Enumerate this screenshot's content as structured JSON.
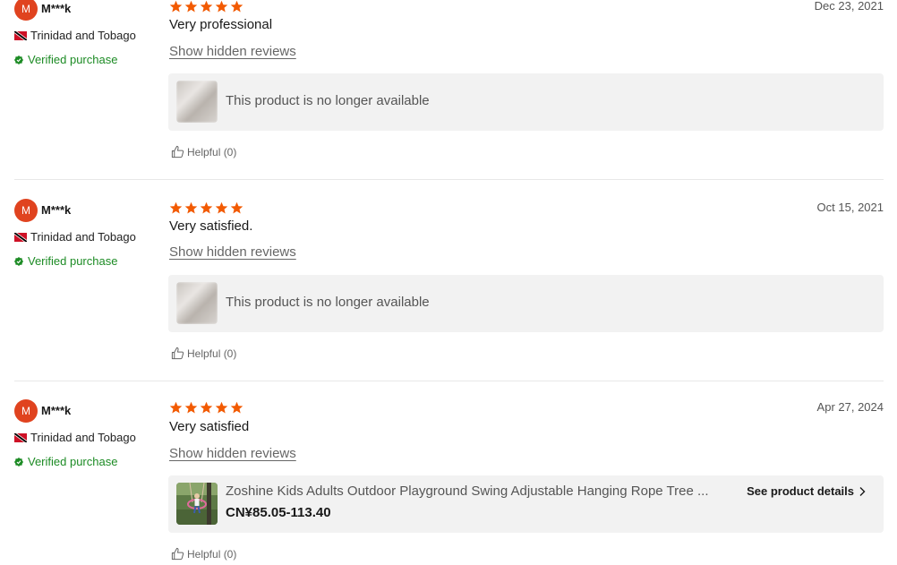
{
  "colors": {
    "star": "#f25a02",
    "avatar": "#e0431f",
    "verified": "#1c8b24"
  },
  "reviews": [
    {
      "avatar_letter": "M",
      "author": "M***k",
      "country": "Trinidad and Tobago",
      "verified": "Verified purchase",
      "rating": 5,
      "date": "Dec 23, 2021",
      "text": "Very professional",
      "show_hidden": "Show hidden reviews",
      "product_message": "This product is no longer available",
      "helpful": "Helpful (0)"
    },
    {
      "avatar_letter": "M",
      "author": "M***k",
      "country": "Trinidad and Tobago",
      "verified": "Verified purchase",
      "rating": 5,
      "date": "Oct 15, 2021",
      "text": "Very satisfied.",
      "show_hidden": "Show hidden reviews",
      "product_message": "This product is no longer available",
      "helpful": "Helpful (0)"
    },
    {
      "avatar_letter": "M",
      "author": "M***k",
      "country": "Trinidad and Tobago",
      "verified": "Verified purchase",
      "rating": 5,
      "date": "Apr 27, 2024",
      "text": "Very satisfied",
      "show_hidden": "Show hidden reviews",
      "product_title": "Zoshine Kids Adults Outdoor Playground Swing Adjustable Hanging Rope Tree ...",
      "product_price": "CN¥85.05-113.40",
      "see_details": "See product details",
      "helpful": "Helpful (0)"
    }
  ]
}
